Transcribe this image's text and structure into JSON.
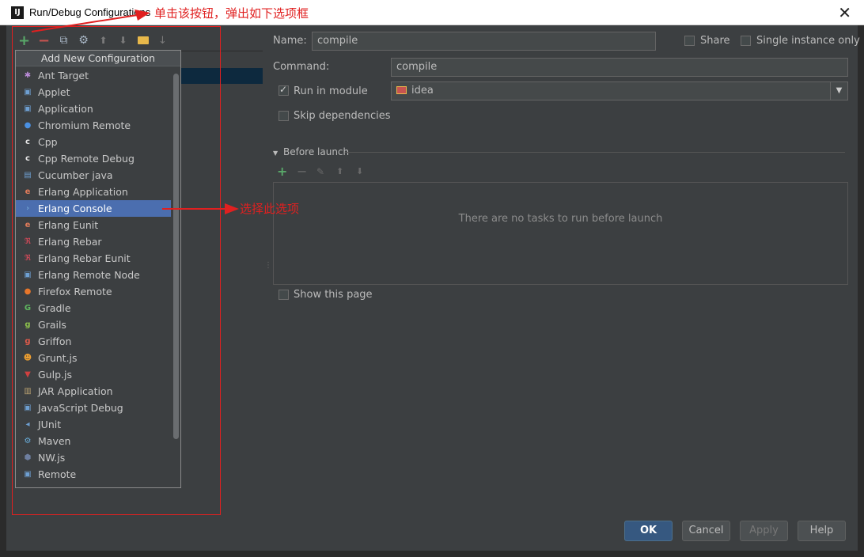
{
  "window": {
    "title": "Run/Debug Configurations",
    "app_icon": "IJ"
  },
  "annotations": {
    "title_note": "单击该按钮，弹出如下选项框",
    "select_note": "选择此选项"
  },
  "toolbar": {
    "add": "+",
    "remove": "−",
    "copy": "⧉",
    "edit": "⚙",
    "up": "⬆",
    "down": "⬇",
    "folder": "▭",
    "sort": "↓"
  },
  "popup": {
    "header": "Add New Configuration",
    "items": [
      {
        "label": "Ant Target",
        "icon": "ant-icon",
        "color": "#b98ad6",
        "glyph": "✱"
      },
      {
        "label": "Applet",
        "icon": "applet-icon",
        "color": "#6e9fd1",
        "glyph": "▣"
      },
      {
        "label": "Application",
        "icon": "application-icon",
        "color": "#6e9fd1",
        "glyph": "▣"
      },
      {
        "label": "Chromium Remote",
        "icon": "chromium-icon",
        "color": "#4a90e2",
        "glyph": "●"
      },
      {
        "label": "Cpp",
        "icon": "cpp-icon",
        "color": "#e8e8e8",
        "glyph": "c"
      },
      {
        "label": "Cpp Remote Debug",
        "icon": "cpp-remote-icon",
        "color": "#e8e8e8",
        "glyph": "c"
      },
      {
        "label": "Cucumber java",
        "icon": "cucumber-icon",
        "color": "#6e9fd1",
        "glyph": "▤"
      },
      {
        "label": "Erlang Application",
        "icon": "erlang-app-icon",
        "color": "#e07b5a",
        "glyph": "e"
      },
      {
        "label": "Erlang Console",
        "icon": "erlang-console-icon",
        "color": "#6e9fd1",
        "glyph": "›"
      },
      {
        "label": "Erlang Eunit",
        "icon": "erlang-eunit-icon",
        "color": "#e07b5a",
        "glyph": "e"
      },
      {
        "label": "Erlang Rebar",
        "icon": "erlang-rebar-icon",
        "color": "#d84a5a",
        "glyph": "ℜ"
      },
      {
        "label": "Erlang Rebar Eunit",
        "icon": "erlang-rebar-eunit-icon",
        "color": "#d84a5a",
        "glyph": "ℜ"
      },
      {
        "label": "Erlang Remote Node",
        "icon": "erlang-remote-icon",
        "color": "#6e9fd1",
        "glyph": "▣"
      },
      {
        "label": "Firefox Remote",
        "icon": "firefox-icon",
        "color": "#e8762a",
        "glyph": "●"
      },
      {
        "label": "Gradle",
        "icon": "gradle-icon",
        "color": "#5fb85f",
        "glyph": "G"
      },
      {
        "label": "Grails",
        "icon": "grails-icon",
        "color": "#8cc04c",
        "glyph": "g"
      },
      {
        "label": "Griffon",
        "icon": "griffon-icon",
        "color": "#e05a4a",
        "glyph": "g"
      },
      {
        "label": "Grunt.js",
        "icon": "grunt-icon",
        "color": "#f0a030",
        "glyph": "☻"
      },
      {
        "label": "Gulp.js",
        "icon": "gulp-icon",
        "color": "#d04040",
        "glyph": "▼"
      },
      {
        "label": "JAR Application",
        "icon": "jar-icon",
        "color": "#b8a070",
        "glyph": "▥"
      },
      {
        "label": "JavaScript Debug",
        "icon": "js-debug-icon",
        "color": "#6e9fd1",
        "glyph": "▣"
      },
      {
        "label": "JUnit",
        "icon": "junit-icon",
        "color": "#6e9fd1",
        "glyph": "◂"
      },
      {
        "label": "Maven",
        "icon": "maven-icon",
        "color": "#6ab0de",
        "glyph": "⚙"
      },
      {
        "label": "NW.js",
        "icon": "nwjs-icon",
        "color": "#6e7fa0",
        "glyph": "⬢"
      },
      {
        "label": "Remote",
        "icon": "remote-icon",
        "color": "#6e9fd1",
        "glyph": "▣"
      }
    ],
    "selected_index": 8
  },
  "form": {
    "name_label": "Name:",
    "name_value": "compile",
    "share_label": "Share",
    "single_instance_label": "Single instance only",
    "command_label": "Command:",
    "command_value": "compile",
    "run_in_module_label": "Run in module",
    "module_value": "idea",
    "skip_deps_label": "Skip dependencies",
    "before_launch_label": "Before launch",
    "no_tasks_text": "There are no tasks to run before launch",
    "show_page_label": "Show this page"
  },
  "buttons": {
    "ok": "OK",
    "cancel": "Cancel",
    "apply": "Apply",
    "help": "Help"
  }
}
